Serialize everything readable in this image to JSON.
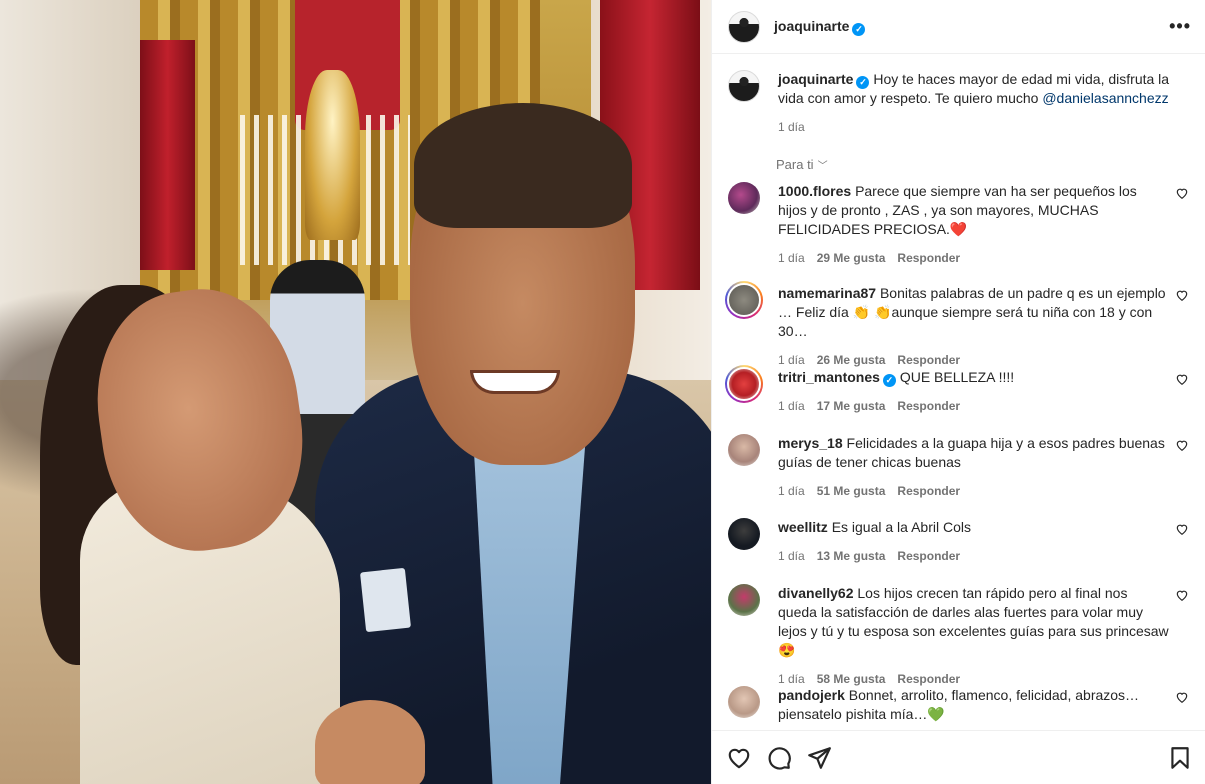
{
  "post": {
    "username": "joaquinarte",
    "caption": "Hoy te haces mayor de edad mi vida, disfruta la vida con amor y respeto. Te quiero mucho",
    "caption_mention": "@danielasannchezz",
    "time": "1 día"
  },
  "sort_label": "Para ti",
  "reply_label": "Responder",
  "comments": [
    {
      "user": "1000.flores",
      "text": "Parece que siempre van ha ser pequeños los hijos y de pronto , ZAS , ya son mayores, MUCHAS FELICIDADES PRECIOSA.❤️",
      "time": "1 día",
      "likes": "29 Me gusta"
    },
    {
      "user": "namemarina87",
      "text": "Bonitas palabras de un padre q es un ejemplo … Feliz día 👏 👏aunque siempre será tu niña con 18 y con 30…",
      "time": "1 día",
      "likes": "26 Me gusta"
    },
    {
      "user": "tritri_mantones",
      "text": "QUE BELLEZA !!!!",
      "time": "1 día",
      "likes": "17 Me gusta"
    },
    {
      "user": "merys_18",
      "text": "Felicidades a la guapa hija y a esos padres buenas guías de tener chicas buenas",
      "time": "1 día",
      "likes": "51 Me gusta"
    },
    {
      "user": "weellitz",
      "text": "Es igual a la Abril Cols",
      "time": "1 día",
      "likes": "13 Me gusta"
    },
    {
      "user": "divanelly62",
      "text": "Los hijos crecen tan rápido pero al final nos queda la satisfacción de darles alas fuertes para volar muy lejos y tú y tu esposa son excelentes guías para sus princesaw😍",
      "time": "1 día",
      "likes": "58 Me gusta"
    },
    {
      "user": "pandojerk",
      "text": "Bonnet, arrolito, flamenco, felicidad, abrazos… piensatelo pishita mía…💚",
      "time": "",
      "likes": ""
    }
  ],
  "colors": {
    "verified": "#0095f6",
    "link": "#00376b",
    "muted": "#737373",
    "like_heart": "#ed4956"
  },
  "icons": {
    "more": "more-horizontal-icon",
    "heart": "heart-outline-icon",
    "comment": "comment-bubble-icon",
    "share": "send-paper-plane-icon",
    "save": "bookmark-icon"
  }
}
